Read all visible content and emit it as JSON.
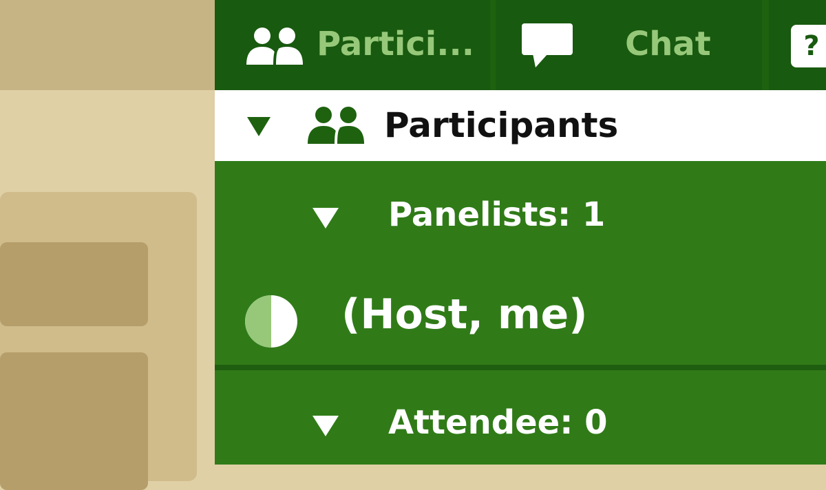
{
  "tabs": {
    "participants_label": "Partici...",
    "chat_label": "Chat",
    "help_label": "?"
  },
  "section": {
    "title": "Participants"
  },
  "groups": {
    "panelists_label": "Panelists: 1",
    "attendees_label": "Attendee: 0"
  },
  "host": {
    "label": "(Host, me)"
  },
  "colors": {
    "tab_bg": "#185a0f",
    "tab_text": "#97c87a",
    "list_bg": "#307b18",
    "left_panel": "#e0d0a6",
    "status_half": "#97c87a"
  },
  "icons": [
    "people-icon",
    "chat-bubble-icon",
    "help-icon",
    "caret-down-icon",
    "half-circle-status-icon"
  ]
}
